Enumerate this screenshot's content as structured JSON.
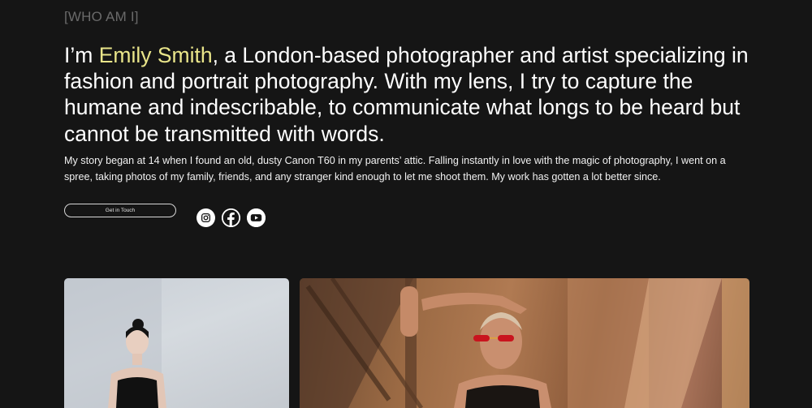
{
  "about": {
    "section_label": "[WHO AM I]",
    "headline_intro": "I’m ",
    "headline_name": "Emily Smith",
    "headline_rest": ", a London-based photographer and artist specializing in fashion and portrait photography. With my lens, I try to capture the humane and indescribable, to communicate what longs to be heard but cannot be transmitted with words.",
    "bio": "My story began at 14 when I found an old, dusty Canon T60 in my parents’ attic. Falling instantly in love with the magic of photography, I went on a spree, taking photos of my family, friends, and any stranger kind enough to let me shoot them. My work has gotten a lot better since.",
    "cta_label": "Get in Touch"
  },
  "socials": [
    {
      "icon": "instagram-icon"
    },
    {
      "icon": "facebook-icon"
    },
    {
      "icon": "youtube-icon"
    }
  ],
  "colors": {
    "background": "#151515",
    "accent": "#e9e58a",
    "label_gray": "#6a6a6a"
  },
  "gallery": {
    "photos": [
      {
        "description_icon": "portrait-photo"
      },
      {
        "description_icon": "portrait-photo"
      }
    ]
  }
}
